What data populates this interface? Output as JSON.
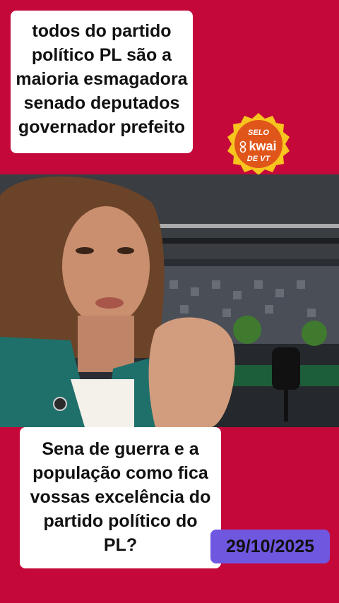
{
  "top_caption": {
    "lines": [
      "todos do partido",
      "político PL são a",
      "maioria esmagadora",
      "senado deputados",
      "governador prefeito"
    ]
  },
  "badge": {
    "line1": "SELO",
    "line2": "kwai",
    "line3": "DE VT",
    "icon": "kwai-logo-icon"
  },
  "video": {
    "description_icons": [
      "person-speaking",
      "studio-background",
      "microphone-icon"
    ]
  },
  "bottom_caption": {
    "lines": [
      "Sena de guerra e a",
      "população como fica",
      "vossas excelência do",
      "partido político do",
      "PL?"
    ]
  },
  "date_label": "29/10/2025",
  "colors": {
    "background": "#c4093a",
    "badge": "#f7c51e",
    "badge_inner": "#e0561a",
    "date_bg": "#6f57e0"
  }
}
